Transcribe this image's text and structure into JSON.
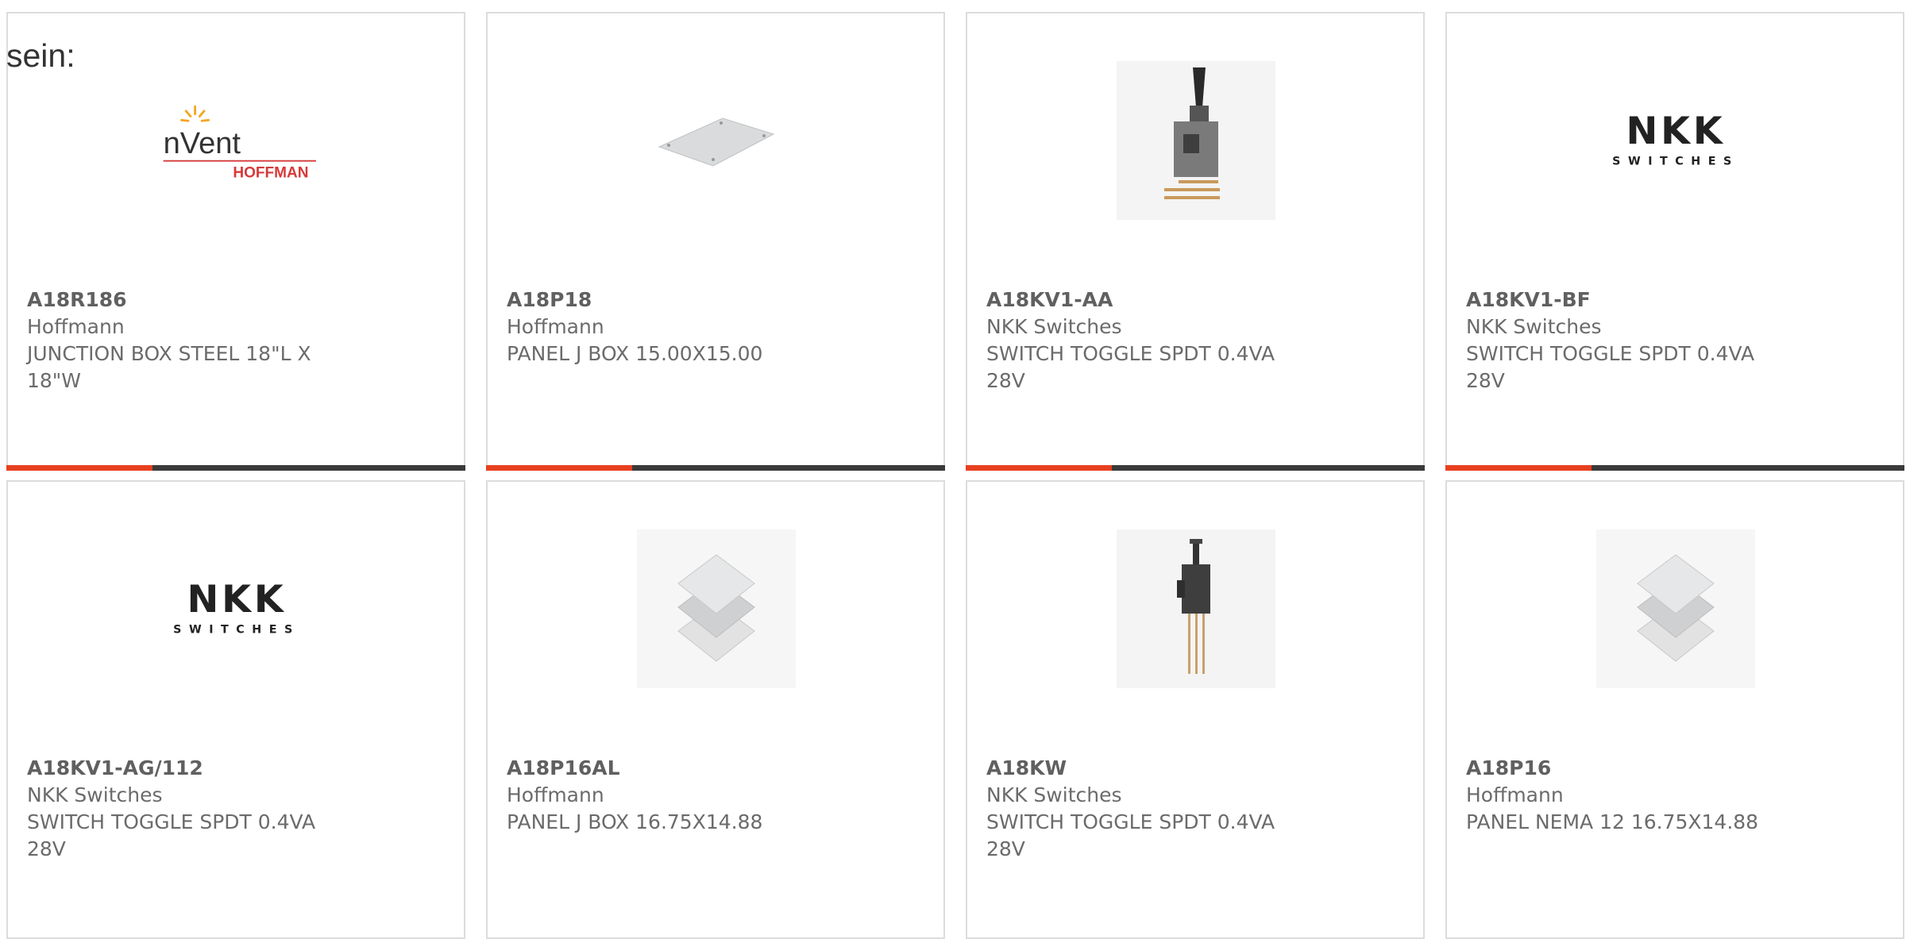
{
  "intro_text": "sein:",
  "colors": {
    "accent": "#e8401f",
    "bar": "#3a3a3a",
    "border": "#dcdcdc"
  },
  "products": [
    {
      "part_number": "A18R186",
      "manufacturer": "Hoffmann",
      "description": "JUNCTION BOX STEEL 18\"L X 18\"W",
      "image": "nvent-hoffman-logo",
      "logo_text": "nVent",
      "logo_subtext": "HOFFMAN"
    },
    {
      "part_number": "A18P18",
      "manufacturer": "Hoffmann",
      "description": "PANEL J BOX 15.00X15.00",
      "image": "panel-plate-image"
    },
    {
      "part_number": "A18KV1-AA",
      "manufacturer": "NKK Switches",
      "description": "SWITCH TOGGLE SPDT 0.4VA 28V",
      "image": "toggle-switch-image"
    },
    {
      "part_number": "A18KV1-BF",
      "manufacturer": "NKK Switches",
      "description": "SWITCH TOGGLE SPDT 0.4VA 28V",
      "image": "nkk-switches-logo",
      "logo_text": "NKK",
      "logo_subtext": "SWITCHES"
    },
    {
      "part_number": "A18KV1-AG/112",
      "manufacturer": "NKK Switches",
      "description": "SWITCH TOGGLE SPDT 0.4VA 28V",
      "image": "nkk-switches-logo",
      "logo_text": "NKK",
      "logo_subtext": "SWITCHES"
    },
    {
      "part_number": "A18P16AL",
      "manufacturer": "Hoffmann",
      "description": "PANEL J BOX 16.75X14.88",
      "image": "stacked-panels-image"
    },
    {
      "part_number": "A18KW",
      "manufacturer": "NKK Switches",
      "description": "SWITCH TOGGLE SPDT 0.4VA 28V",
      "image": "toggle-switch-pins-image"
    },
    {
      "part_number": "A18P16",
      "manufacturer": "Hoffmann",
      "description": "PANEL NEMA 12 16.75X14.88",
      "image": "stacked-panels-image"
    }
  ]
}
